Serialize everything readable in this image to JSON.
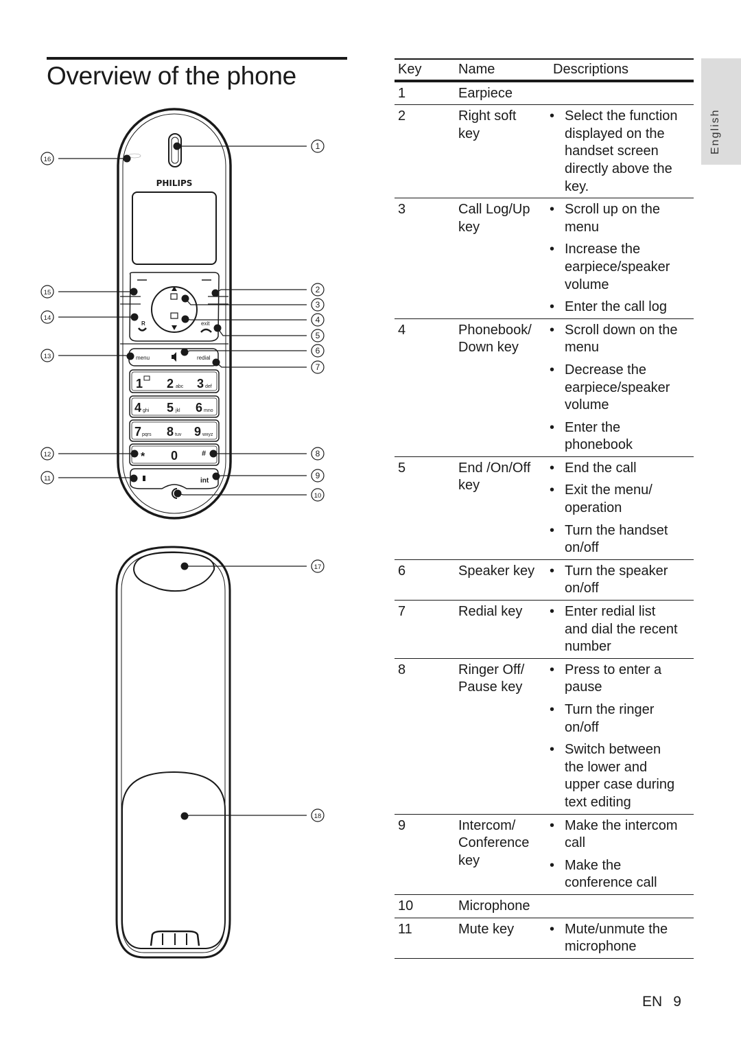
{
  "title": "Overview of the phone",
  "side_tab": "English",
  "phone": {
    "brand": "PHILIPS",
    "keys": {
      "menu": "menu",
      "exit": "exit",
      "redial": "redial",
      "r": "R",
      "int": "int",
      "k1": "1",
      "k2": "2",
      "k2s": "abc",
      "k3": "3",
      "k3s": "def",
      "k4": "4",
      "k4s": "ghi",
      "k5": "5",
      "k5s": "jkl",
      "k6": "6",
      "k6s": "mno",
      "k7": "7",
      "k7s": "pqrs",
      "k8": "8",
      "k8s": "tuv",
      "k9": "9",
      "k9s": "wxyz",
      "star": "*",
      "k0": "0",
      "hash": "#"
    },
    "callouts": [
      "1",
      "2",
      "3",
      "4",
      "5",
      "6",
      "7",
      "8",
      "9",
      "10",
      "11",
      "12",
      "13",
      "14",
      "15",
      "16",
      "17",
      "18"
    ]
  },
  "table": {
    "headers": [
      "Key",
      "Name",
      "Descriptions"
    ],
    "rows": [
      {
        "key": "1",
        "name": "Earpiece",
        "desc": []
      },
      {
        "key": "2",
        "name": "Right soft\nkey",
        "desc": [
          "Select the function\ndisplayed on the\nhandset screen\ndirectly above the\nkey."
        ]
      },
      {
        "key": "3",
        "name": "Call Log/Up\nkey",
        "desc": [
          "Scroll up on the\nmenu",
          "Increase the\nearpiece/speaker\nvolume",
          "Enter the call log"
        ]
      },
      {
        "key": "4",
        "name": "Phonebook/\nDown key",
        "desc": [
          "Scroll down on the\nmenu",
          "Decrease the\nearpiece/speaker\nvolume",
          "Enter the\nphonebook"
        ]
      },
      {
        "key": "5",
        "name": "End /On/Off\nkey",
        "desc": [
          "End the call",
          "Exit the menu/\noperation",
          "Turn the handset\non/off"
        ]
      },
      {
        "key": "6",
        "name": "Speaker key",
        "desc": [
          "Turn the speaker\non/off"
        ]
      },
      {
        "key": "7",
        "name": "Redial key",
        "desc": [
          "Enter redial list\nand dial the recent\nnumber"
        ]
      },
      {
        "key": "8",
        "name": "Ringer Off/\nPause key",
        "desc": [
          "Press to enter a\npause",
          "Turn the ringer\non/off",
          "Switch between\nthe lower and\nupper case during\ntext editing"
        ]
      },
      {
        "key": "9",
        "name": "Intercom/\nConference\nkey",
        "desc": [
          "Make the intercom\ncall",
          "Make the\nconference call"
        ]
      },
      {
        "key": "10",
        "name": "Microphone",
        "desc": []
      },
      {
        "key": "11",
        "name": "Mute key",
        "desc": [
          "Mute/unmute the\nmicrophone"
        ]
      }
    ]
  },
  "footer": {
    "lang": "EN",
    "page": "9"
  }
}
